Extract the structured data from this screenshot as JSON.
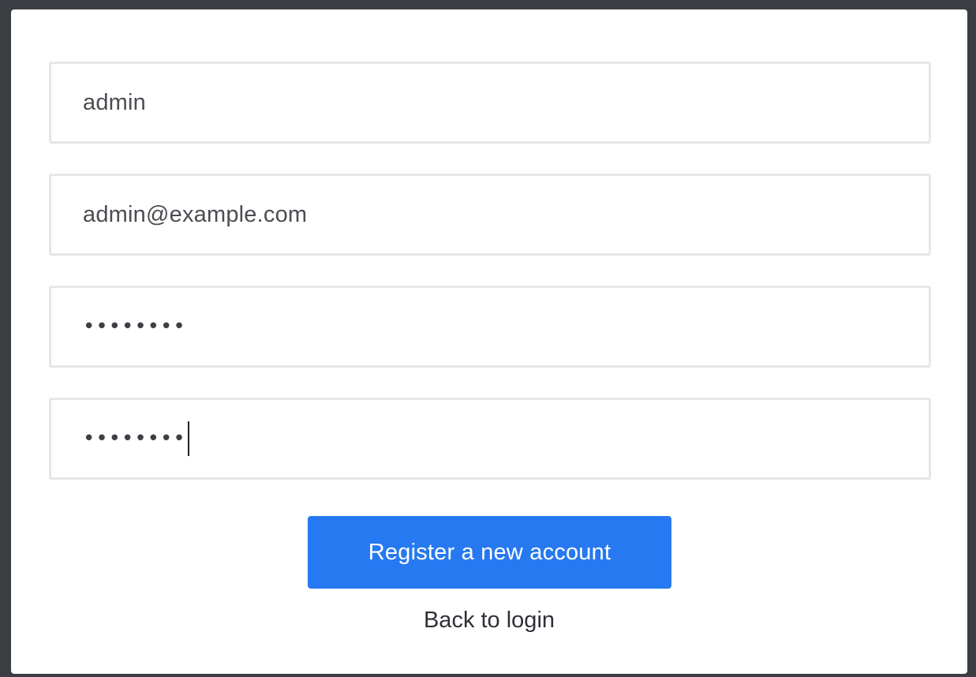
{
  "form": {
    "username_value": "admin",
    "email_value": "admin@example.com",
    "password_masked": "••••••••",
    "confirm_password_masked": "••••••••",
    "submit_label": "Register a new account",
    "back_link_label": "Back to login"
  },
  "colors": {
    "primary": "#2679f0",
    "background_frame": "#3a3d42",
    "field_border": "#e4e7ea"
  }
}
